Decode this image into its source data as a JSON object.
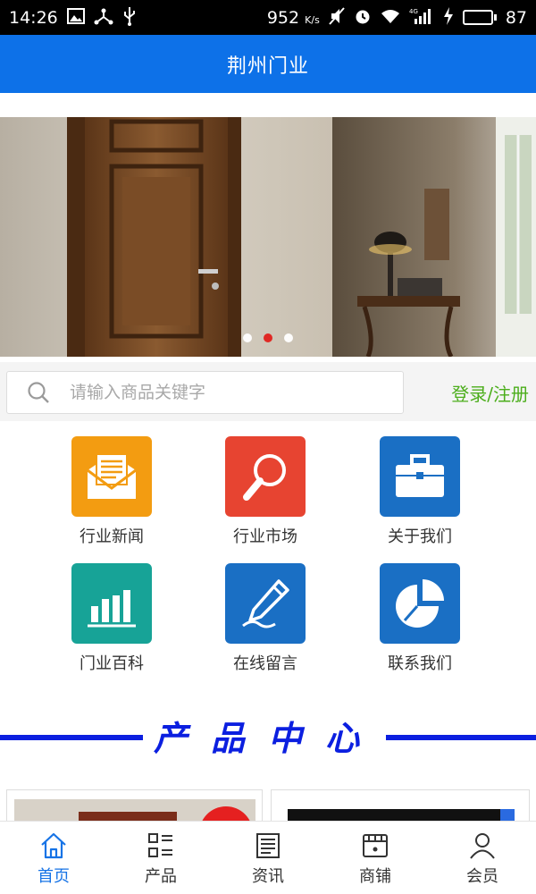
{
  "status_bar": {
    "time": "14:26",
    "speed": "952",
    "speed_unit": "K/s",
    "network": "4G",
    "battery_percent": "87",
    "battery_level": 0.87
  },
  "app_bar": {
    "title": "荆州门业"
  },
  "banner": {
    "slide_count": 3,
    "active_slide": 2
  },
  "search": {
    "placeholder": "请输入商品关键字",
    "login_label": "登录/注册"
  },
  "grid": [
    {
      "label": "行业新闻",
      "icon": "newsletter-icon",
      "color": "#f39c11"
    },
    {
      "label": "行业市场",
      "icon": "magnifier-icon",
      "color": "#e74431"
    },
    {
      "label": "关于我们",
      "icon": "briefcase-icon",
      "color": "#1a6fc4"
    },
    {
      "label": "门业百科",
      "icon": "bar-chart-icon",
      "color": "#17a397"
    },
    {
      "label": "在线留言",
      "icon": "pen-icon",
      "color": "#1a6fc4"
    },
    {
      "label": "联系我们",
      "icon": "pie-chart-icon",
      "color": "#1a6fc4"
    }
  ],
  "section": {
    "title": "产品中心",
    "color": "#0b1fe0"
  },
  "bottom_nav": [
    {
      "label": "首页",
      "icon": "home-icon",
      "active": true
    },
    {
      "label": "产品",
      "icon": "grid-list-icon",
      "active": false
    },
    {
      "label": "资讯",
      "icon": "news-icon",
      "active": false
    },
    {
      "label": "商铺",
      "icon": "shop-icon",
      "active": false
    },
    {
      "label": "会员",
      "icon": "user-icon",
      "active": false
    }
  ],
  "colors": {
    "primary": "#0d71e8",
    "accent_green": "#4cae1c",
    "nav_active": "#1673e6"
  }
}
